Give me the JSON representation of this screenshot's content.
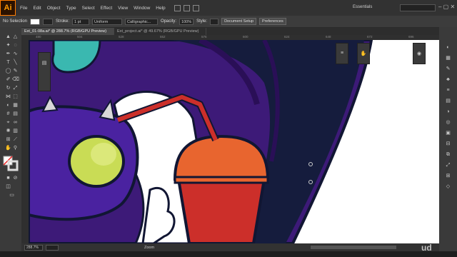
{
  "app": {
    "logo": "Ai"
  },
  "menu": {
    "items": [
      "File",
      "Edit",
      "Object",
      "Type",
      "Select",
      "Effect",
      "View",
      "Window",
      "Help"
    ]
  },
  "workspace": {
    "label": "Essentials"
  },
  "control": {
    "selection": "No Selection",
    "stroke_label": "Stroke:",
    "stroke_value": "1 pt",
    "profile": "Uniform",
    "brush": "Calligraphic...",
    "opacity_label": "Opacity:",
    "opacity_value": "100%",
    "style_label": "Style:",
    "doc_setup": "Document Setup",
    "preferences": "Preferences"
  },
  "tabs": [
    {
      "label": "Ext_01-08a.ai* @ 288.7% (RGB/GPU Preview)",
      "active": true
    },
    {
      "label": "Ext_project.ai* @ 49.67% (RGB/GPU Preview)",
      "active": false
    }
  ],
  "ruler": {
    "ticks": [
      "480",
      "504",
      "528",
      "552",
      "576",
      "600",
      "624",
      "648",
      "672",
      "696"
    ]
  },
  "status": {
    "zoom": "288.7%",
    "mode": "Zoom"
  },
  "colors": {
    "purple": "#3d1a78",
    "dark_purple": "#2a0f57",
    "navy": "#151c3d",
    "outline": "#111633",
    "orange": "#e8652f",
    "red": "#cc2f2a",
    "lime": "#c9dc55",
    "teal": "#3ab8b0"
  },
  "watermark": "ud"
}
